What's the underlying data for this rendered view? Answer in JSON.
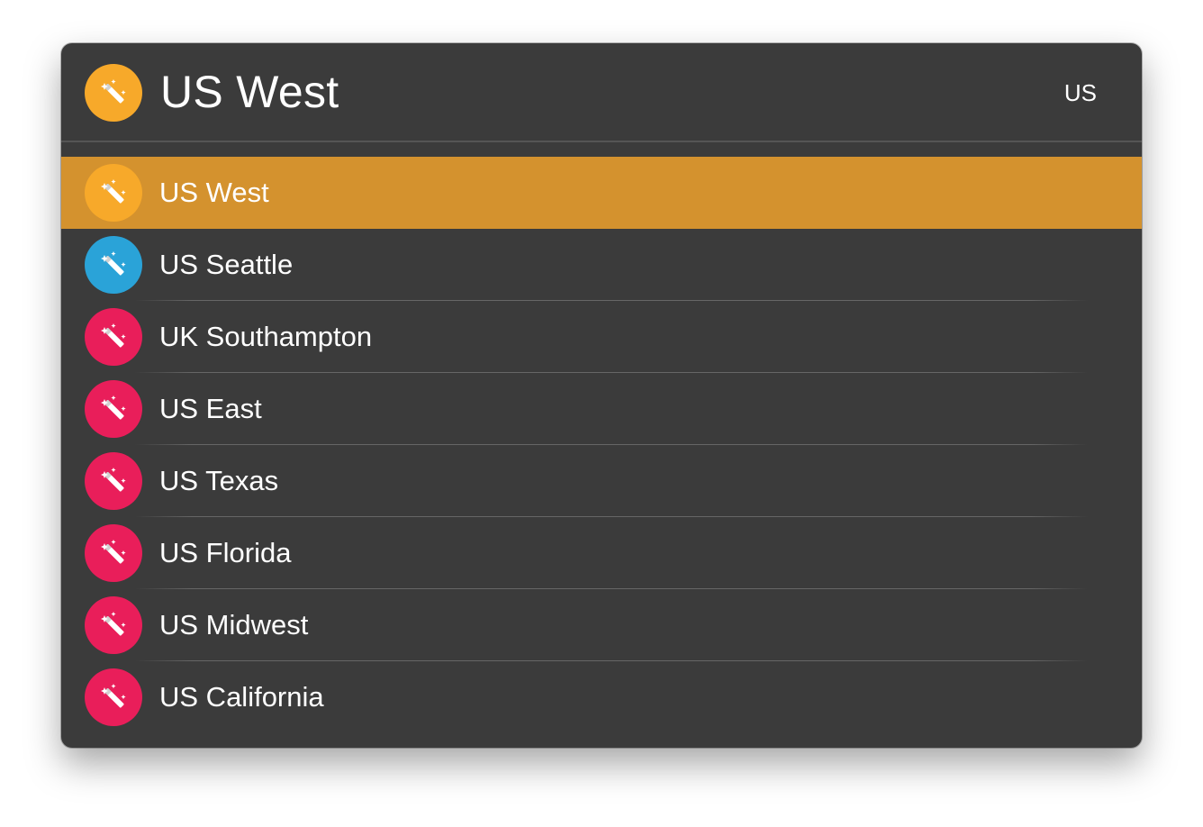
{
  "colors": {
    "window_bg": "#3b3b3b",
    "selected_row": "#d4922e",
    "badge_orange": "#f7a92a",
    "badge_blue": "#2aa3d8",
    "badge_red": "#e91e5a",
    "text": "#ffffff"
  },
  "header": {
    "title": "US West",
    "query": "US",
    "icon": "magic-wand-icon",
    "icon_color": "#f7a92a"
  },
  "results": [
    {
      "label": "US West",
      "icon": "magic-wand-icon",
      "icon_color": "#f7a92a",
      "selected": true
    },
    {
      "label": "US Seattle",
      "icon": "magic-wand-icon",
      "icon_color": "#2aa3d8",
      "selected": false
    },
    {
      "label": "UK Southampton",
      "icon": "magic-wand-icon",
      "icon_color": "#e91e5a",
      "selected": false
    },
    {
      "label": "US East",
      "icon": "magic-wand-icon",
      "icon_color": "#e91e5a",
      "selected": false
    },
    {
      "label": "US Texas",
      "icon": "magic-wand-icon",
      "icon_color": "#e91e5a",
      "selected": false
    },
    {
      "label": "US Florida",
      "icon": "magic-wand-icon",
      "icon_color": "#e91e5a",
      "selected": false
    },
    {
      "label": "US Midwest",
      "icon": "magic-wand-icon",
      "icon_color": "#e91e5a",
      "selected": false
    },
    {
      "label": "US California",
      "icon": "magic-wand-icon",
      "icon_color": "#e91e5a",
      "selected": false
    }
  ]
}
